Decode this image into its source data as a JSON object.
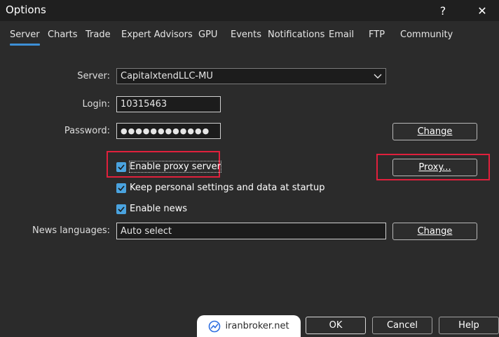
{
  "window": {
    "title": "Options",
    "help_glyph": "?",
    "close_glyph": "✕"
  },
  "tabs": [
    {
      "label": "Server"
    },
    {
      "label": "Charts"
    },
    {
      "label": "Trade"
    },
    {
      "label": "Expert Advisors"
    },
    {
      "label": "GPU"
    },
    {
      "label": "Events"
    },
    {
      "label": "Notifications"
    },
    {
      "label": "Email"
    },
    {
      "label": "FTP"
    },
    {
      "label": "Community"
    }
  ],
  "active_tab": "Server",
  "form": {
    "server_label": "Server:",
    "server_value": "CapitalxtendLLC-MU",
    "login_label": "Login:",
    "login_value": "10315463",
    "password_label": "Password:",
    "password_value": "●●●●●●●●●●●●",
    "change_password_label": "Change",
    "proxy_button_label": "Proxy...",
    "enable_proxy_label": "Enable proxy server",
    "enable_proxy_checked": true,
    "keep_settings_label": "Keep personal settings and data at startup",
    "keep_settings_checked": true,
    "enable_news_label": "Enable news",
    "enable_news_checked": true,
    "news_languages_label": "News languages:",
    "news_languages_value": "Auto select",
    "change_news_label": "Change"
  },
  "footer": {
    "watermark_text": "iranbroker.net",
    "ok_label": "OK",
    "cancel_label": "Cancel",
    "help_label": "Help"
  },
  "colors": {
    "accent": "#3d8fd6",
    "checkbox": "#4aa3df",
    "highlight": "#e0203c",
    "background": "#2b2b2b"
  },
  "icons": {
    "help": "question-mark-icon",
    "close": "close-icon",
    "dropdown": "chevron-down-icon",
    "check": "checkmark-icon",
    "watermark_logo": "chart-logo-icon"
  }
}
